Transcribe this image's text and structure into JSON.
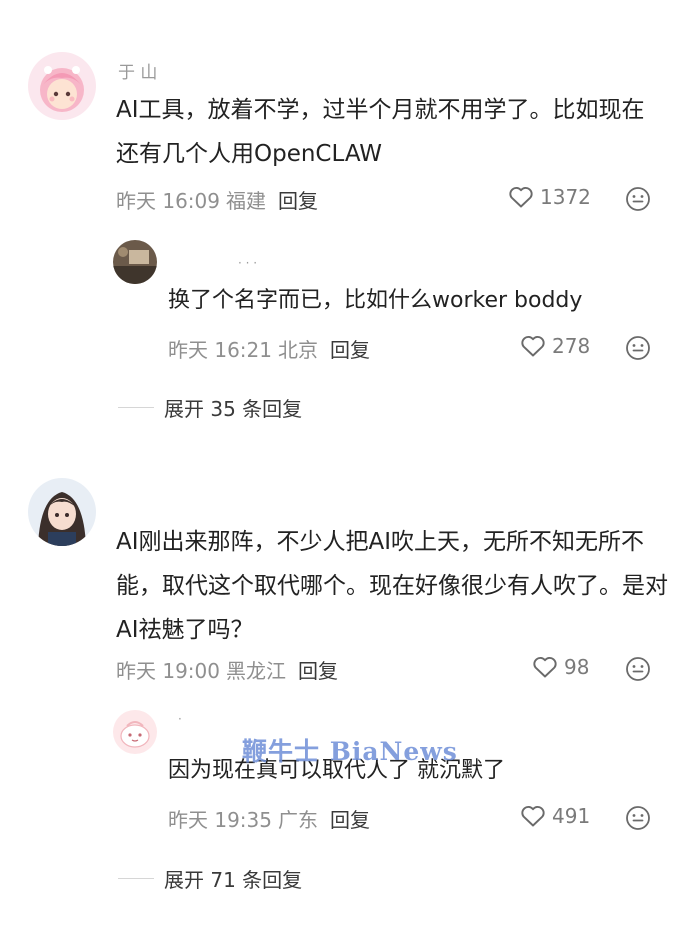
{
  "comments": [
    {
      "username": "于 山",
      "avatar": "pink-hair-doll-avatar",
      "text": "AI工具，放着不学，过半个月就不用学了。比如现在还有几个人用OpenCLAW",
      "time": "昨天 16:09",
      "location": "福建",
      "reply_label": "回复",
      "likes": "1372",
      "reply": {
        "username": "· · ·",
        "avatar": "photo-avatar",
        "text": "换了个名字而已，比如什么worker boddy",
        "time": "昨天 16:21",
        "location": "北京",
        "reply_label": "回复",
        "likes": "278"
      },
      "expand_label": "展开 35 条回复"
    },
    {
      "username": "",
      "avatar": "anime-girl-avatar",
      "text": "AI刚出来那阵，不少人把AI吹上天，无所不知无所不能，取代这个取代哪个。现在好像很少有人吹了。是对AI祛魅了吗？",
      "time": "昨天 19:00",
      "location": "黑龙江",
      "reply_label": "回复",
      "likes": "98",
      "reply": {
        "username": "·",
        "avatar": "pink-blob-avatar",
        "text": "因为现在真可以取代人了 就沉默了",
        "time": "昨天 19:35",
        "location": "广东",
        "reply_label": "回复",
        "likes": "491"
      },
      "expand_label": "展开 71 条回复"
    }
  ],
  "watermark": "鞭牛士 BiaNews",
  "colors": {
    "text": "#222222",
    "meta": "#8f8f8f",
    "icon": "#6a6a6a",
    "watermark": "#6f8fd8"
  }
}
